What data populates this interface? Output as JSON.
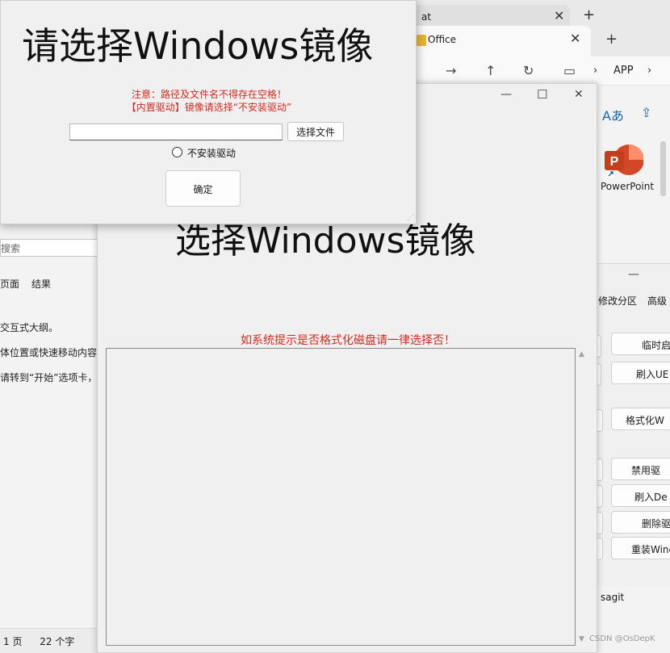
{
  "dialog": {
    "title": "请选择Windows镜像",
    "note_line1": "注意：路径及文件名不得存在空格！",
    "note_line2": "【内置驱动】镜像请选择“不安装驱动”",
    "path_value": "",
    "browse_label": "选择文件",
    "radio_label": "不安装驱动",
    "ok_label": "确定"
  },
  "main_window": {
    "title": "选择Windows镜像",
    "warning": "如系统提示是否格式化磁盘请一律选择否！",
    "log_text": ""
  },
  "doc_window": {
    "search": "搜索",
    "nav": [
      "页面",
      "结果"
    ],
    "lines": [
      "交互式大纲。",
      "体位置或快速移动内容",
      "请转到“开始”选项卡，并"
    ],
    "status_page": "1 页",
    "status_words": "22 个字"
  },
  "browser": {
    "back_tab": "at",
    "front_tab": "Office",
    "crumb": "APP"
  },
  "office": {
    "app_label": "PowerPoint"
  },
  "tool_window": {
    "tabs": [
      "修改分区",
      "高级"
    ],
    "buttons": [
      "临时启",
      "刷入UE",
      "格式化W",
      "禁用驱",
      "刷入De",
      "删除驱",
      "重装Wind"
    ],
    "footer": "sagit"
  },
  "watermark": "CSDN @OsDepK",
  "colors": {
    "warning": "#d6281f",
    "window_bg": "#f0f0f0",
    "ppt_orange": "#d24726"
  }
}
